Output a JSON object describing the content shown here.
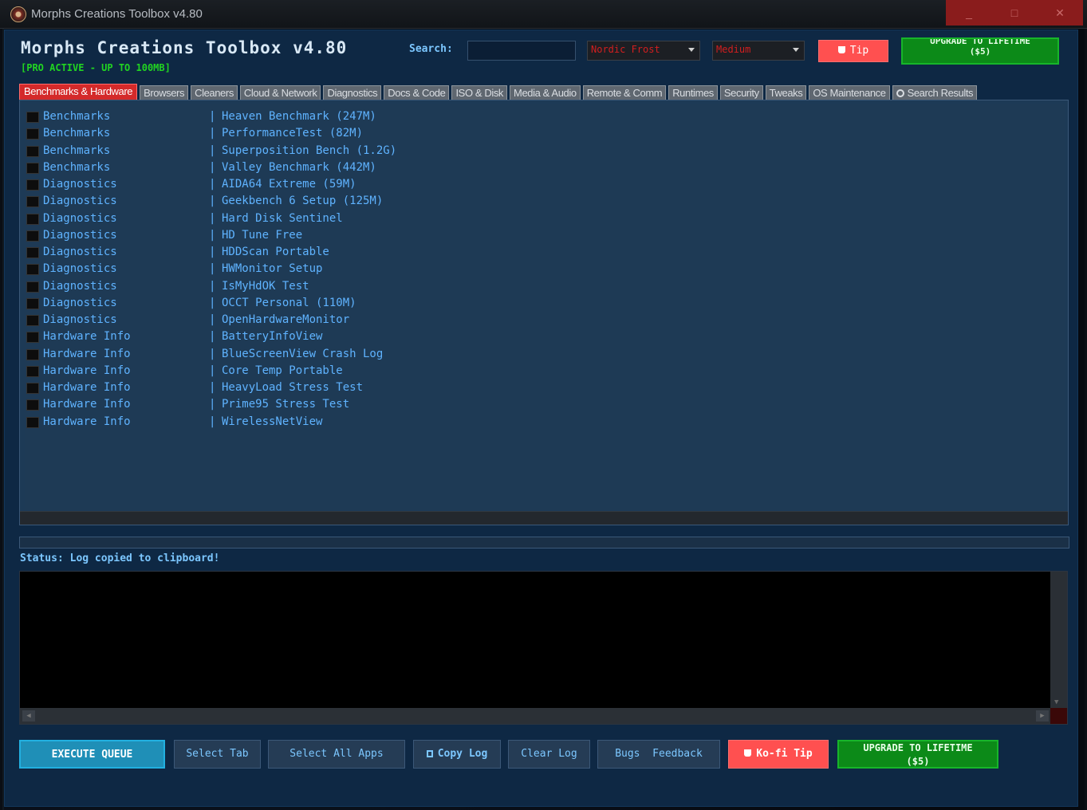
{
  "window": {
    "title": "Morphs Creations Toolbox v4.80",
    "min_label": "_",
    "max_label": "□",
    "close_label": "✕"
  },
  "header": {
    "app_title": "Morphs Creations Toolbox v4.80",
    "pro_status": "[PRO ACTIVE - UP TO 100MB]",
    "search_label": "Search:",
    "search_value": "",
    "theme_selected": "Nordic Frost",
    "size_selected": "Medium",
    "tip_label": "Tip",
    "upgrade_line1": "UPGRADE TO LIFETIME",
    "upgrade_line2": "($5)"
  },
  "tabs": [
    {
      "label": "Benchmarks & Hardware",
      "active": true
    },
    {
      "label": "Browsers"
    },
    {
      "label": "Cleaners"
    },
    {
      "label": "Cloud & Network"
    },
    {
      "label": "Diagnostics"
    },
    {
      "label": "Docs & Code"
    },
    {
      "label": "ISO & Disk"
    },
    {
      "label": "Media & Audio"
    },
    {
      "label": "Remote & Comm"
    },
    {
      "label": "Runtimes"
    },
    {
      "label": "Security"
    },
    {
      "label": "Tweaks"
    },
    {
      "label": "OS Maintenance"
    },
    {
      "label": "Search Results",
      "icon": "magnifier-icon"
    }
  ],
  "list": {
    "separator": "|",
    "rows": [
      {
        "category": "Benchmarks",
        "app": "Heaven Benchmark (247M)"
      },
      {
        "category": "Benchmarks",
        "app": "PerformanceTest (82M)"
      },
      {
        "category": "Benchmarks",
        "app": "Superposition Bench (1.2G)"
      },
      {
        "category": "Benchmarks",
        "app": "Valley Benchmark (442M)"
      },
      {
        "category": "Diagnostics",
        "app": "AIDA64 Extreme (59M)"
      },
      {
        "category": "Diagnostics",
        "app": "Geekbench 6 Setup (125M)"
      },
      {
        "category": "Diagnostics",
        "app": "Hard Disk Sentinel"
      },
      {
        "category": "Diagnostics",
        "app": "HD Tune Free"
      },
      {
        "category": "Diagnostics",
        "app": "HDDScan Portable"
      },
      {
        "category": "Diagnostics",
        "app": "HWMonitor Setup"
      },
      {
        "category": "Diagnostics",
        "app": "IsMyHdOK Test"
      },
      {
        "category": "Diagnostics",
        "app": "OCCT Personal (110M)"
      },
      {
        "category": "Diagnostics",
        "app": "OpenHardwareMonitor"
      },
      {
        "category": "Hardware Info",
        "app": "BatteryInfoView"
      },
      {
        "category": "Hardware Info",
        "app": "BlueScreenView Crash Log"
      },
      {
        "category": "Hardware Info",
        "app": "Core Temp Portable"
      },
      {
        "category": "Hardware Info",
        "app": "HeavyLoad Stress Test"
      },
      {
        "category": "Hardware Info",
        "app": "Prime95 Stress Test"
      },
      {
        "category": "Hardware Info",
        "app": "WirelessNetView"
      }
    ]
  },
  "status": {
    "text": "Status: Log copied to clipboard!"
  },
  "log": {
    "content": ""
  },
  "buttons": {
    "execute_queue": "EXECUTE QUEUE",
    "select_tab": "Select Tab",
    "select_all_apps": "Select All Apps",
    "copy_log": "Copy Log",
    "clear_log": "Clear Log",
    "bugs_feedback": "Bugs  Feedback",
    "kofi_tip": "Ko-fi Tip",
    "upgrade_line1": "UPGRADE TO LIFETIME",
    "upgrade_line2": "($5)"
  },
  "colors": {
    "accent_blue": "#5fb3ff",
    "active_tab": "#d42a2a",
    "tip_red": "#ff5050",
    "upgrade_green": "#0c8a18",
    "execute_cyan": "#1f8fb7",
    "pro_green": "#21d421"
  }
}
